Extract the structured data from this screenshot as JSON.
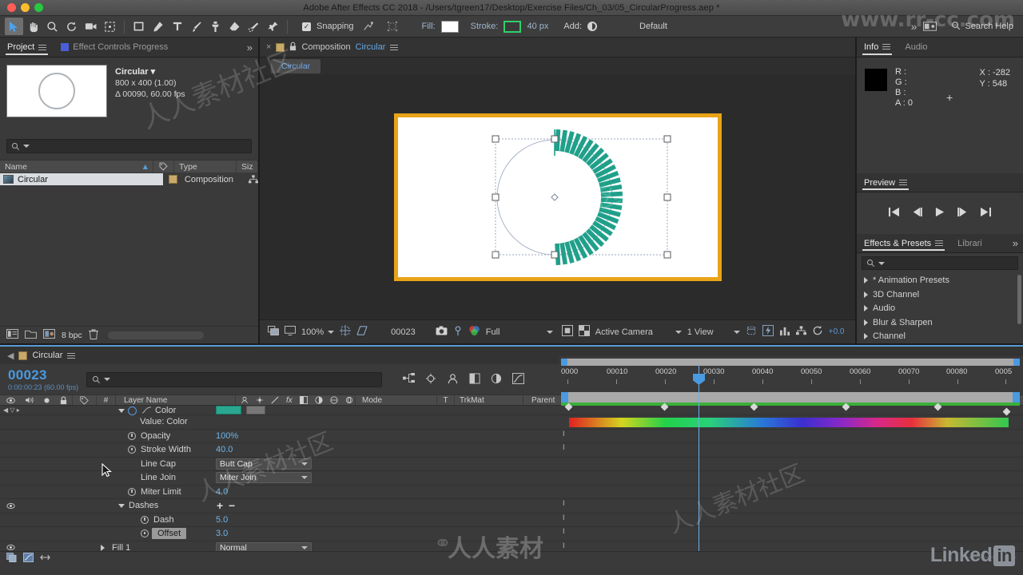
{
  "window": {
    "title": "Adobe After Effects CC 2018 - /Users/tgreen17/Desktop/Exercise Files/Ch_03/05_CircularProgress.aep *"
  },
  "toolbar": {
    "snapping_label": "Snapping",
    "snapping_checked": "✓",
    "fill_label": "Fill:",
    "stroke_label": "Stroke:",
    "stroke_width": "40 px",
    "add_label": "Add:",
    "workspace": "Default",
    "search_help": "Search Help",
    "stroke_color": "#2fd06a",
    "fill_color": "#ffffff"
  },
  "project": {
    "tabs": [
      {
        "label": "Project",
        "selected": true
      },
      {
        "label": "Effect Controls Progress",
        "selected": false
      }
    ],
    "item_name": "Circular ▾",
    "item_size": "800 x 400 (1.00)",
    "item_duration": "Δ 00090, 60.00 fps",
    "search_placeholder": "",
    "columns": [
      "Name",
      "Type",
      "Siz"
    ],
    "rows": [
      {
        "name": "Circular",
        "type": "Composition"
      }
    ],
    "bit_depth": "8 bpc"
  },
  "composition": {
    "tab_close": "×",
    "tab_label_prefix": "Composition",
    "tab_label_name": "Circular",
    "chip": "Circular",
    "zoom": "100%",
    "time": "00023",
    "resolution": "Full",
    "camera": "Active Camera",
    "views": "1 View",
    "exposure": "+0.0"
  },
  "info": {
    "tabs": [
      {
        "label": "Info",
        "selected": true
      },
      {
        "label": "Audio",
        "selected": false
      }
    ],
    "r": "R :",
    "g": "G :",
    "b": "B :",
    "a": "A : 0",
    "x": "X : -282",
    "y": "Y : 548"
  },
  "preview": {
    "title": "Preview"
  },
  "effects": {
    "tabs": [
      {
        "label": "Effects & Presets",
        "selected": true
      },
      {
        "label": "Librari",
        "selected": false
      }
    ],
    "search_placeholder": "",
    "items": [
      "* Animation Presets",
      "3D Channel",
      "Audio",
      "Blur & Sharpen",
      "Channel"
    ]
  },
  "timeline": {
    "tab_label": "Circular",
    "current_time": "00023",
    "current_time_sub": "0:00:00:23 (60.00 fps)",
    "search_placeholder": "",
    "columns": [
      "Layer Name",
      "Mode",
      "T",
      "TrkMat",
      "Parent"
    ],
    "column_hash": "#",
    "rows": [
      {
        "name": "Color",
        "value": "",
        "kind": "color-swatch",
        "indent": 148,
        "eye": false,
        "twirl": "down",
        "stopwatch": "keyed"
      },
      {
        "name": "Value: Color",
        "value": "",
        "kind": "static",
        "indent": 175,
        "eye": false,
        "twirl": "none",
        "stopwatch": "none"
      },
      {
        "name": "Opacity",
        "value": "100%",
        "kind": "value",
        "indent": 160,
        "eye": false,
        "twirl": "none",
        "stopwatch": "plain"
      },
      {
        "name": "Stroke Width",
        "value": "40.0",
        "kind": "value",
        "indent": 160,
        "eye": false,
        "twirl": "none",
        "stopwatch": "plain"
      },
      {
        "name": "Line Cap",
        "value": "Butt Cap",
        "kind": "dropdown",
        "indent": 160,
        "eye": false,
        "twirl": "none",
        "stopwatch": "none"
      },
      {
        "name": "Line Join",
        "value": "Miter Join",
        "kind": "dropdown",
        "indent": 160,
        "eye": false,
        "twirl": "none",
        "stopwatch": "none"
      },
      {
        "name": "Miter Limit",
        "value": "4.0",
        "kind": "value",
        "indent": 160,
        "eye": false,
        "twirl": "none",
        "stopwatch": "plain"
      },
      {
        "name": "Dashes",
        "value": "",
        "kind": "plusminus",
        "indent": 160,
        "eye": true,
        "twirl": "down",
        "stopwatch": "none"
      },
      {
        "name": "Dash",
        "value": "5.0",
        "kind": "value",
        "indent": 175,
        "eye": false,
        "twirl": "none",
        "stopwatch": "plain"
      },
      {
        "name": "Offset",
        "value": "3.0",
        "kind": "value-sel",
        "indent": 175,
        "eye": false,
        "twirl": "none",
        "stopwatch": "plain"
      },
      {
        "name": "Fill 1",
        "value": "Normal",
        "kind": "dropdown",
        "indent": 140,
        "eye": true,
        "twirl": "right",
        "stopwatch": "none"
      }
    ],
    "ruler_labels": [
      "0000",
      "00010",
      "00020",
      "00030",
      "00040",
      "00050",
      "00060",
      "00070",
      "00080",
      "0005"
    ],
    "plus_label": "+",
    "minus_label": "−"
  },
  "watermarks": {
    "site": "www.rr-cc.com",
    "community": "人人素材社区",
    "brand": "人人素材",
    "linkedin": "Linked",
    "linkedin_in": "in"
  }
}
